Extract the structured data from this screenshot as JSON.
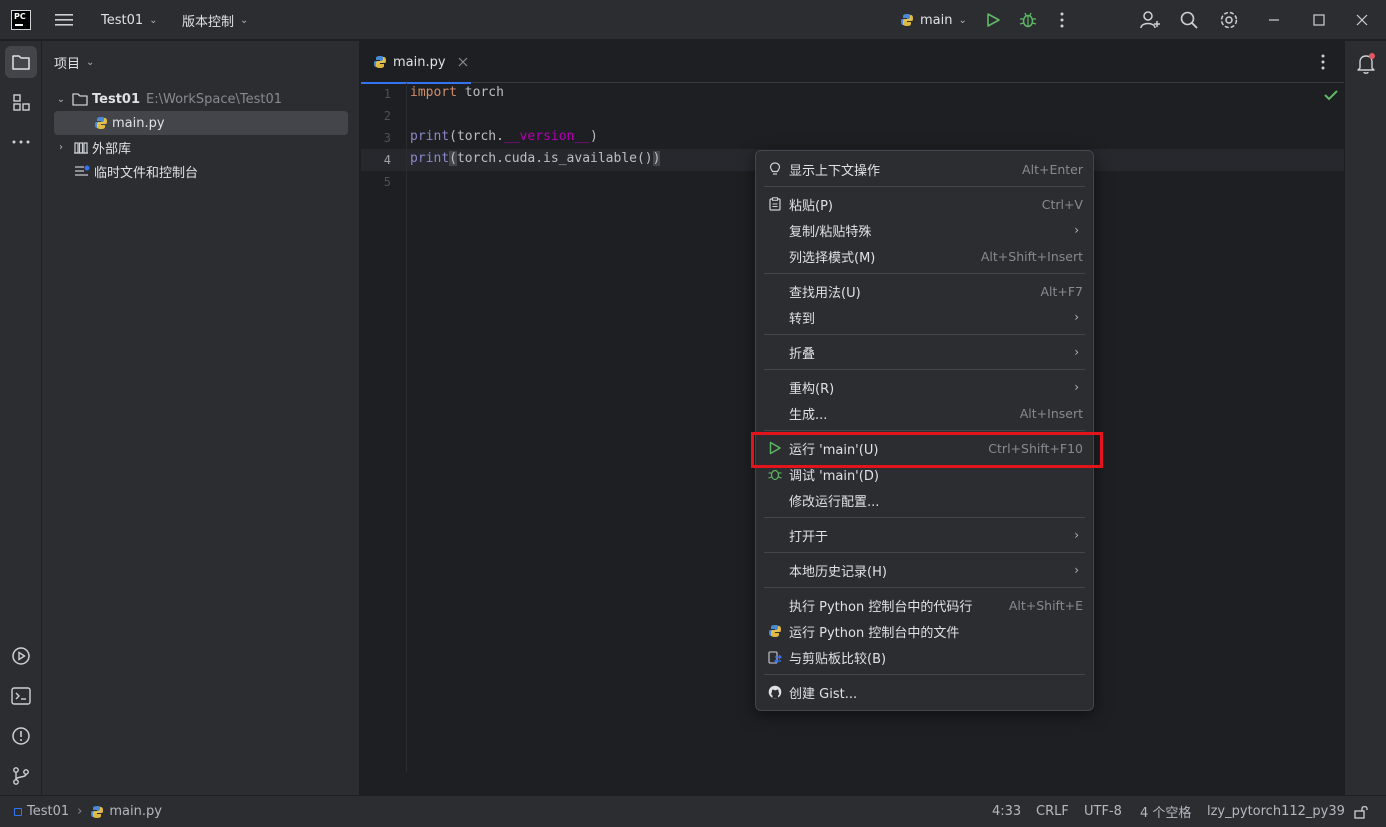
{
  "titlebar": {
    "project": "Test01",
    "vcs": "版本控制",
    "run_config": "main"
  },
  "project_panel": {
    "title": "项目",
    "root_name": "Test01",
    "root_path": "E:\\WorkSpace\\Test01",
    "file": "main.py",
    "ext_libs": "外部库",
    "scratches": "临时文件和控制台"
  },
  "editor": {
    "tab": "main.py",
    "line_numbers": [
      "1",
      "2",
      "3",
      "4",
      "5"
    ],
    "lines": {
      "l1_kw": "import",
      "l1_rest": " torch",
      "l3_fn": "print",
      "l3_a": "(torch.",
      "l3_b": "__version__",
      "l3_c": ")",
      "l4_fn": "print",
      "l4_a": "(",
      "l4_b": "torch.cuda.is_available()",
      "l4_c": ")"
    }
  },
  "context_menu": {
    "items": [
      {
        "label": "显示上下文操作",
        "shortcut": "Alt+Enter"
      },
      {
        "label": "粘贴(P)",
        "shortcut": "Ctrl+V"
      },
      {
        "label": "复制/粘贴特殊",
        "shortcut": ""
      },
      {
        "label": "列选择模式(M)",
        "shortcut": "Alt+Shift+Insert"
      },
      {
        "label": "查找用法(U)",
        "shortcut": "Alt+F7"
      },
      {
        "label": "转到",
        "shortcut": ""
      },
      {
        "label": "折叠",
        "shortcut": ""
      },
      {
        "label": "重构(R)",
        "shortcut": ""
      },
      {
        "label": "生成...",
        "shortcut": "Alt+Insert"
      },
      {
        "label": "运行 'main'(U)",
        "shortcut": "Ctrl+Shift+F10"
      },
      {
        "label": "调试 'main'(D)",
        "shortcut": ""
      },
      {
        "label": "修改运行配置...",
        "shortcut": ""
      },
      {
        "label": "打开于",
        "shortcut": ""
      },
      {
        "label": "本地历史记录(H)",
        "shortcut": ""
      },
      {
        "label": "执行 Python 控制台中的代码行",
        "shortcut": "Alt+Shift+E"
      },
      {
        "label": "运行 Python 控制台中的文件",
        "shortcut": ""
      },
      {
        "label": "与剪贴板比较(B)",
        "shortcut": ""
      },
      {
        "label": "创建 Gist...",
        "shortcut": ""
      }
    ]
  },
  "statusbar": {
    "project": "Test01",
    "file": "main.py",
    "position": "4:33",
    "line_sep": "CRLF",
    "encoding": "UTF-8",
    "indent": "4 个空格",
    "interpreter": "lzy_pytorch112_py39"
  },
  "colors": {
    "run_green": "#5fb865",
    "highlight_red": "#e3141c",
    "accent_blue": "#3574f0"
  }
}
